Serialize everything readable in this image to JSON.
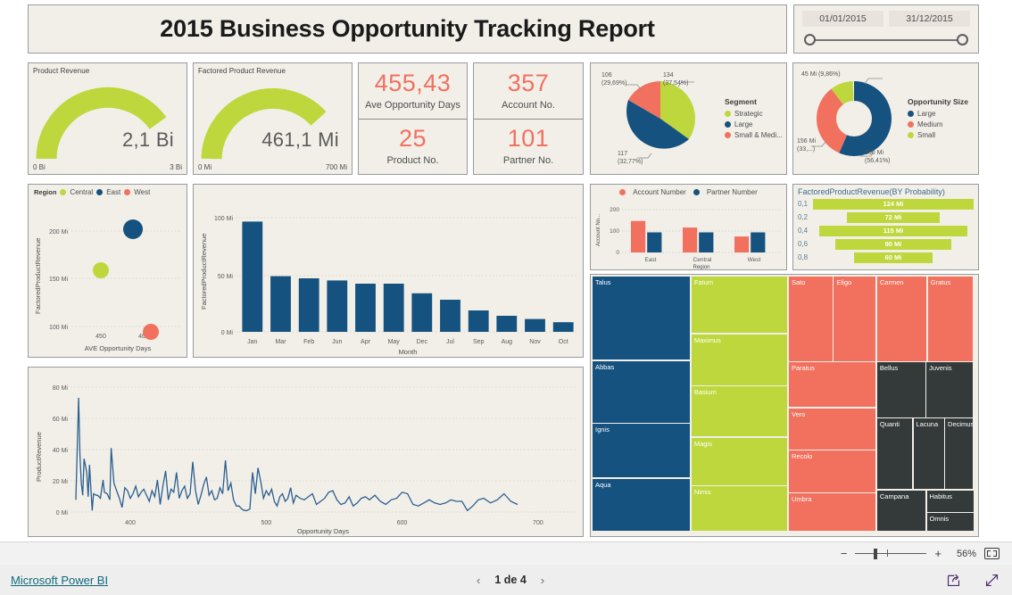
{
  "header": {
    "title": "2015 Business Opportunity Tracking Report",
    "slicer": {
      "start": "01/01/2015",
      "end": "31/12/2015"
    }
  },
  "gauges": [
    {
      "title": "Product Revenue",
      "value": "2,1 Bi",
      "min": "0 Bi",
      "max": "3 Bi",
      "pct": 70
    },
    {
      "title": "Factored Product Revenue",
      "value": "461,1 Mi",
      "min": "0 Mi",
      "max": "700 Mi",
      "pct": 66
    }
  ],
  "kpis": [
    {
      "value": "455,43",
      "label": "Ave Opportunity Days"
    },
    {
      "value": "25",
      "label": "Product No."
    },
    {
      "value": "357",
      "label": "Account No."
    },
    {
      "value": "101",
      "label": "Partner No."
    }
  ],
  "colors": {
    "green": "#bed73c",
    "navy": "#15527f",
    "salmon": "#f2705e",
    "dark": "#343a3a",
    "line": "#2a5f8f",
    "text": "#4d4d4d",
    "panel": "#f2efe9"
  },
  "funnel": {
    "title": "FactoredProductRevenue(BY Probability)",
    "categories": [
      "0,1",
      "0,2",
      "0,4",
      "0,6",
      "0,8"
    ],
    "labels": [
      "124 Mi",
      "72 Mi",
      "115 Mi",
      "90 Mi",
      "60 Mi"
    ],
    "values": [
      124,
      72,
      115,
      90,
      60
    ]
  },
  "footer": {
    "link": "Microsoft Power BI",
    "page": "1 de 4",
    "prev": "‹",
    "next": "›",
    "zoom": "56%",
    "zoom_minus": "−",
    "zoom_plus": "+"
  },
  "chart_data": [
    {
      "id": "segment_pie",
      "type": "pie",
      "title": "",
      "legend_title": "Segment",
      "legend_position": "right",
      "categories": [
        "Strategic",
        "Large",
        "Small & Medi..."
      ],
      "values": [
        134,
        117,
        106
      ],
      "percents": [
        "37,54%",
        "32,77%",
        "29,69%"
      ],
      "labels": [
        "134\n(37,54%)",
        "117\n(32,77%)",
        "106\n(29,69%)"
      ],
      "colors": [
        "#bed73c",
        "#15527f",
        "#f2705e"
      ]
    },
    {
      "id": "opportunity_size_donut",
      "type": "pie",
      "title": "",
      "legend_title": "Opportunity Size",
      "legend_position": "right",
      "categories": [
        "Large",
        "Medium",
        "Small"
      ],
      "values": [
        260,
        156,
        45
      ],
      "percents": [
        "56,41%",
        "33,...",
        "9,86%"
      ],
      "labels": [
        "260 Mi\n(56,41%)",
        "156 Mi\n(33,...)",
        "45 Mi (9,86%)"
      ],
      "colors": [
        "#15527f",
        "#f2705e",
        "#bed73c"
      ]
    },
    {
      "id": "region_scatter",
      "type": "scatter",
      "legend_title": "Region",
      "xlabel": "AVE Opportunity Days",
      "ylabel": "FactoredProductRevenue",
      "xticks": [
        "450",
        "460"
      ],
      "yticks": [
        "100 Mi",
        "150 Mi",
        "200 Mi"
      ],
      "xlim": [
        443,
        466
      ],
      "ylim": [
        95,
        215
      ],
      "points": [
        {
          "name": "East",
          "x": 457.5,
          "y": 200,
          "size": 17,
          "color": "#15527f"
        },
        {
          "name": "Central",
          "x": 450.5,
          "y": 160,
          "size": 14,
          "color": "#bed73c"
        },
        {
          "name": "West",
          "x": 461.5,
          "y": 99,
          "size": 13,
          "color": "#f2705e"
        }
      ]
    },
    {
      "id": "monthly_factored_revenue",
      "type": "bar",
      "xlabel": "Month",
      "ylabel": "FactoredProductRevenue",
      "yticks": [
        "0 Mi",
        "50 Mi",
        "100 Mi"
      ],
      "ylim": [
        0,
        110
      ],
      "categories": [
        "Jan",
        "Mar",
        "Feb",
        "Jun",
        "Apr",
        "May",
        "Dec",
        "Jul",
        "Sep",
        "Aug",
        "Nov",
        "Oct"
      ],
      "values": [
        103,
        52,
        50,
        48,
        45,
        45,
        36,
        30,
        20,
        15,
        12,
        9
      ],
      "color": "#15527f"
    },
    {
      "id": "account_partner_by_region",
      "type": "bar",
      "xlabel": "Region",
      "ylabel": "Account No...",
      "yticks": [
        "0",
        "100",
        "200"
      ],
      "ylim": [
        0,
        215
      ],
      "categories": [
        "East",
        "Central",
        "West"
      ],
      "series": [
        {
          "name": "Account Number",
          "values": [
            158,
            125,
            80
          ],
          "color": "#f2705e"
        },
        {
          "name": "Partner Number",
          "values": [
            101,
            101,
            101
          ],
          "color": "#15527f"
        }
      ]
    },
    {
      "id": "factored_revenue_by_probability",
      "type": "bar",
      "title": "FactoredProductRevenue(BY Probability)",
      "categories": [
        "0,1",
        "0,2",
        "0,4",
        "0,6",
        "0,8"
      ],
      "values": [
        124,
        72,
        115,
        90,
        60
      ],
      "color": "#bed73c"
    },
    {
      "id": "product_revenue_by_days",
      "type": "line",
      "xlabel": "Opportunity Days",
      "ylabel": "ProductRevenue",
      "xticks": [
        "400",
        "500",
        "600",
        "700"
      ],
      "yticks": [
        "0 Mi",
        "20 Mi",
        "40 Mi",
        "60 Mi",
        "80 Mi"
      ],
      "xlim": [
        358,
        727
      ],
      "ylim": [
        0,
        82
      ],
      "color": "#2a5f8f",
      "x": [
        360,
        362,
        363,
        364,
        365,
        366,
        368,
        369,
        370,
        372,
        373,
        375,
        376,
        378,
        380,
        381,
        383,
        385,
        386,
        388,
        390,
        392,
        394,
        396,
        398,
        400,
        402,
        404,
        406,
        408,
        410,
        412,
        414,
        416,
        418,
        420,
        422,
        424,
        426,
        428,
        430,
        432,
        434,
        436,
        438,
        440,
        442,
        444,
        446,
        448,
        450,
        452,
        454,
        456,
        458,
        460,
        462,
        464,
        466,
        468,
        470,
        472,
        474,
        476,
        478,
        480,
        482,
        484,
        486,
        488,
        490,
        492,
        494,
        496,
        498,
        500,
        502,
        504,
        506,
        508,
        510,
        512,
        514,
        516,
        518,
        520,
        522,
        525,
        528,
        531,
        534,
        537,
        540,
        543,
        546,
        549,
        552,
        555,
        558,
        561,
        564,
        567,
        570,
        573,
        576,
        580,
        584,
        588,
        592,
        596,
        600,
        604,
        608,
        612,
        616,
        620,
        624,
        628,
        632,
        636,
        640,
        644,
        648,
        652,
        656,
        660,
        665,
        670,
        675,
        680,
        685,
        690,
        695,
        700,
        705,
        710,
        715,
        720,
        725
      ],
      "y": [
        8,
        75,
        37,
        19,
        11,
        35,
        26,
        10,
        31,
        1,
        12,
        11,
        11,
        9,
        21,
        13,
        12,
        8,
        42,
        19,
        14,
        9,
        3,
        16,
        14,
        9,
        12,
        17,
        10,
        13,
        15,
        11,
        7,
        14,
        10,
        21,
        5,
        17,
        27,
        8,
        15,
        13,
        26,
        9,
        14,
        17,
        9,
        12,
        33,
        14,
        5,
        11,
        18,
        23,
        11,
        14,
        8,
        9,
        16,
        12,
        34,
        14,
        19,
        8,
        4,
        4,
        2,
        1,
        1,
        2,
        26,
        12,
        29,
        20,
        9,
        14,
        11,
        15,
        7,
        4,
        10,
        12,
        7,
        9,
        16,
        6,
        11,
        9,
        8,
        10,
        12,
        5,
        7,
        9,
        13,
        14,
        8,
        5,
        6,
        10,
        4,
        6,
        9,
        10,
        8,
        11,
        7,
        5,
        8,
        9,
        13,
        12,
        5,
        4,
        6,
        8,
        6,
        5,
        6,
        8,
        7,
        7,
        1,
        4,
        8,
        9,
        6,
        8,
        12,
        7,
        5
      ]
    },
    {
      "id": "account_treemap",
      "type": "treemap",
      "groups": [
        {
          "color": "#15527f",
          "tiles": [
            {
              "label": "Talus",
              "h": 33.0
            },
            {
              "label": "Abbas",
              "h": 24.5
            },
            {
              "label": "Ignis",
              "h": 21.5
            },
            {
              "label": "Aqua",
              "h": 21.0
            }
          ]
        },
        {
          "color": "#bed73c",
          "tiles": [
            {
              "label": "Fatum",
              "h": 22.5
            },
            {
              "label": "Maximus",
              "h": 20.5
            },
            {
              "label": "Basium",
              "h": 20.0
            },
            {
              "label": "Magis",
              "h": 19.0
            },
            {
              "label": "Nimis",
              "h": 18.0
            }
          ]
        },
        {
          "color": "#f2705e",
          "tiles": [
            {
              "label": "Sato"
            },
            {
              "label": "Eligo"
            },
            {
              "label": "Carmen"
            },
            {
              "label": "Gratus"
            },
            {
              "label": "Paratus"
            },
            {
              "label": "Vero"
            },
            {
              "label": "Recolo"
            },
            {
              "label": "Umbra"
            }
          ]
        },
        {
          "color": "#343a3a",
          "tiles": [
            {
              "label": "Bellus"
            },
            {
              "label": "Juvenis"
            },
            {
              "label": "Quanti"
            },
            {
              "label": "Lacuna"
            },
            {
              "label": "Decimus"
            },
            {
              "label": "Campana"
            },
            {
              "label": "Habitus"
            },
            {
              "label": "Omnis"
            }
          ]
        }
      ]
    }
  ]
}
